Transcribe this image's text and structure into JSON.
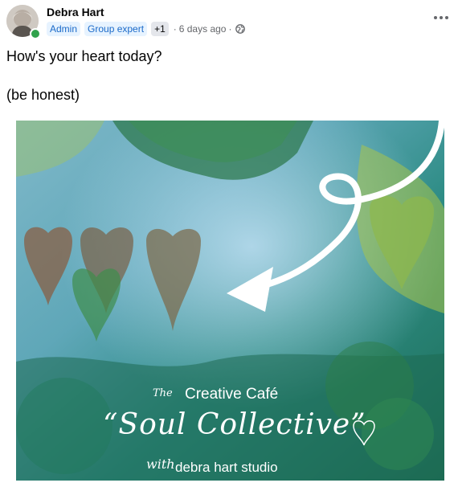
{
  "post": {
    "author": "Debra Hart",
    "badges": [
      "Admin",
      "Group expert"
    ],
    "extra_badges": "+1",
    "separator": "·",
    "time": "6 days ago",
    "privacy_icon": "globe-icon",
    "more_icon": "more-dots-icon",
    "text_line1": "How's your heart today?",
    "text_line2": "(be honest)"
  },
  "image": {
    "overlay_the": "The",
    "overlay_line1": "Creative Café",
    "overlay_line2": "“Soul Collective”",
    "overlay_with": "with",
    "overlay_line3": "debra hart studio",
    "colors": {
      "teal": "#2e8f8a",
      "deep_green": "#1f6b4e",
      "sky": "#8fc9e3",
      "lime": "#a9c44a",
      "rust": "#8a5a3c"
    }
  },
  "colors": {
    "accent": "#1b6ac9",
    "badge_bg": "#e7f3ff",
    "online": "#31a24c",
    "meta": "#65676b"
  }
}
